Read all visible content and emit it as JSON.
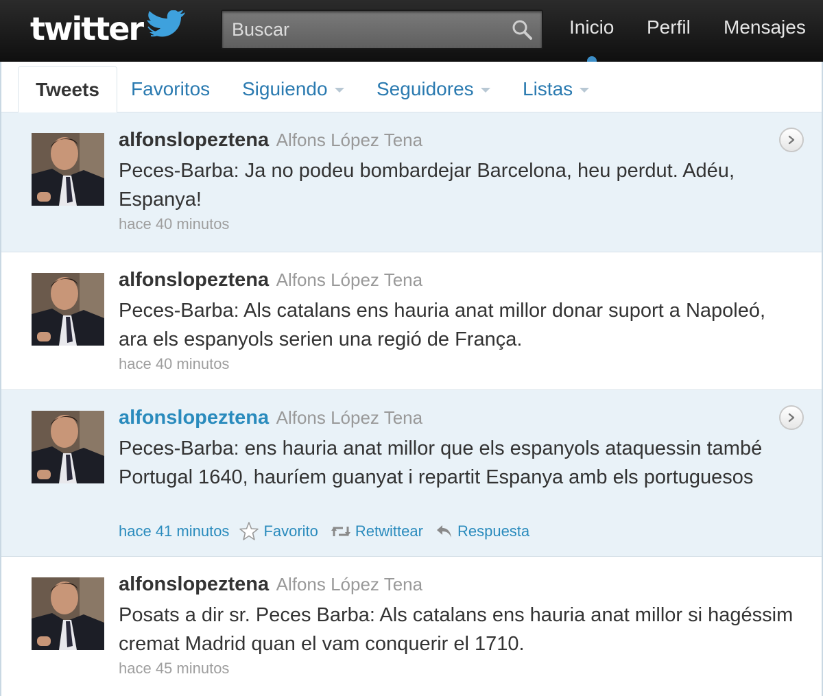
{
  "header": {
    "logo_text": "twitter",
    "search": {
      "placeholder": "Buscar",
      "icon": "search-icon"
    },
    "nav": {
      "inicio": "Inicio",
      "perfil": "Perfil",
      "mensajes": "Mensajes"
    }
  },
  "tabs": {
    "tweets": "Tweets",
    "favoritos": "Favoritos",
    "siguiendo": "Siguiendo",
    "seguidores": "Seguidores",
    "listas": "Listas",
    "active": "Tweets"
  },
  "colors": {
    "topbar": "#1a1a1a",
    "link": "#2a8bbd",
    "highlight_bg": "#e9f2f8",
    "tab_link": "#2a7ab0"
  },
  "tweets": [
    {
      "username": "alfonslopeztena",
      "fullname": "Alfons López Tena",
      "text": "Peces-Barba: Ja no podeu bombardejar Barcelona, heu perdut. Adéu, Espanya!",
      "time": "hace 40 minutos"
    },
    {
      "username": "alfonslopeztena",
      "fullname": "Alfons López Tena",
      "text": "Peces-Barba: Als catalans ens hauria anat millor donar suport a Napoleó, ara els espanyols serien una regió de França.",
      "time": "hace 40 minutos"
    },
    {
      "username": "alfonslopeztena",
      "fullname": "Alfons López Tena",
      "text": "Peces-Barba: ens hauria anat millor que els espanyols ataquessin també Portugal 1640, hauríem guanyat i repartit Espanya amb els portuguesos",
      "time": "hace 41 minutos",
      "actions": {
        "favorite": "Favorito",
        "retweet": "Retwittear",
        "reply": "Respuesta"
      }
    },
    {
      "username": "alfonslopeztena",
      "fullname": "Alfons López Tena",
      "text": "Posats a dir sr. Peces Barba: Als catalans ens hauria anat millor si hagéssim cremat Madrid quan el vam conquerir el 1710.",
      "time": "hace 45 minutos"
    }
  ]
}
